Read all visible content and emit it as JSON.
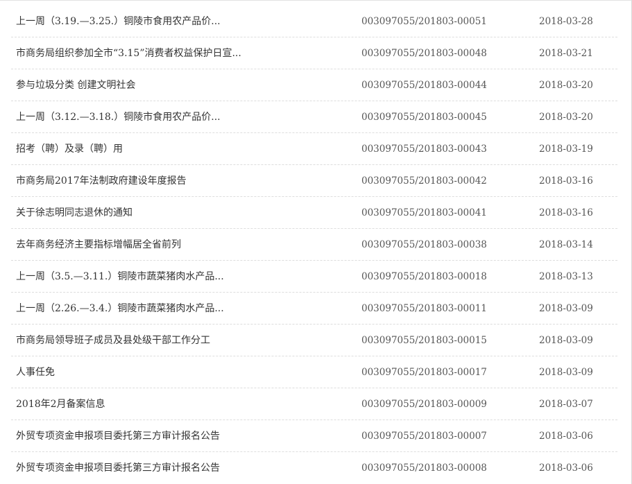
{
  "documents": [
    {
      "title": "上一周（3.19.—3.25.）铜陵市食用农产品价...",
      "number": "003097055/201803-00051",
      "date": "2018-03-28"
    },
    {
      "title": "市商务局组织参加全市“3.15”消费者权益保护日宣...",
      "number": "003097055/201803-00048",
      "date": "2018-03-21"
    },
    {
      "title": "参与垃圾分类 创建文明社会",
      "number": "003097055/201803-00044",
      "date": "2018-03-20"
    },
    {
      "title": "上一周（3.12.—3.18.）铜陵市食用农产品价...",
      "number": "003097055/201803-00045",
      "date": "2018-03-20"
    },
    {
      "title": "招考（聘）及录（聘）用",
      "number": "003097055/201803-00043",
      "date": "2018-03-19"
    },
    {
      "title": "市商务局2017年法制政府建设年度报告",
      "number": "003097055/201803-00042",
      "date": "2018-03-16"
    },
    {
      "title": "关于徐志明同志退休的通知",
      "number": "003097055/201803-00041",
      "date": "2018-03-16"
    },
    {
      "title": "去年商务经济主要指标增幅居全省前列",
      "number": "003097055/201803-00038",
      "date": "2018-03-14"
    },
    {
      "title": "上一周（3.5.—3.11.）铜陵市蔬菜猪肉水产品...",
      "number": "003097055/201803-00018",
      "date": "2018-03-13"
    },
    {
      "title": "上一周（2.26.—3.4.）铜陵市蔬菜猪肉水产品...",
      "number": "003097055/201803-00011",
      "date": "2018-03-09"
    },
    {
      "title": "市商务局领导班子成员及县处级干部工作分工",
      "number": "003097055/201803-00015",
      "date": "2018-03-09"
    },
    {
      "title": "人事任免",
      "number": "003097055/201803-00017",
      "date": "2018-03-09"
    },
    {
      "title": "2018年2月备案信息",
      "number": "003097055/201803-00009",
      "date": "2018-03-07"
    },
    {
      "title": "外贸专项资金申报项目委托第三方审计报名公告",
      "number": "003097055/201803-00007",
      "date": "2018-03-06"
    },
    {
      "title": "外贸专项资金申报项目委托第三方审计报名公告",
      "number": "003097055/201803-00008",
      "date": "2018-03-06"
    }
  ]
}
